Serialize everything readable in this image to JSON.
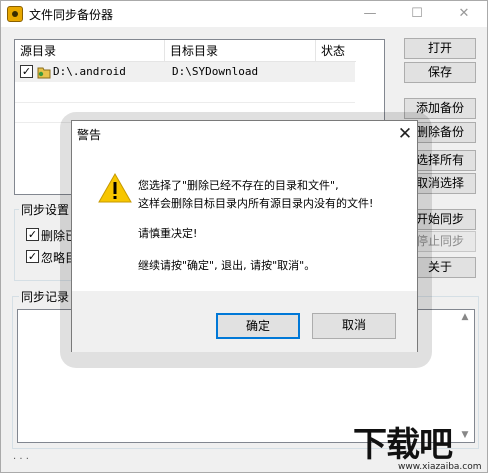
{
  "window": {
    "title": "文件同步备份器",
    "minimize": "—",
    "maximize": "☐",
    "close": "✕"
  },
  "list": {
    "columns": [
      "源目录",
      "目标目录",
      "状态"
    ],
    "rows": [
      {
        "checked": true,
        "source": "D:\\.android",
        "target": "D:\\SYDownload",
        "status": ""
      }
    ]
  },
  "buttons": {
    "open": "打开",
    "save": "保存",
    "add_backup": "添加备份",
    "delete_backup": "删除备份",
    "select_all": "选择所有",
    "deselect": "取消选择",
    "start_sync": "开始同步",
    "stop_sync": "停止同步",
    "about": "关于"
  },
  "sync_settings": {
    "label": "同步设置",
    "option1": {
      "label": "删除已",
      "checked": true
    },
    "option2": {
      "label": "忽略目",
      "checked": true
    }
  },
  "sync_log": {
    "label": "同步记录"
  },
  "statusbar": {
    "text": ". . ."
  },
  "watermark": {
    "logo": "下载吧",
    "url": "www.xiazaiba.com"
  },
  "dialog": {
    "title": "警告",
    "close": "✕",
    "icon": "warning-icon",
    "line1": "您选择了\"删除已经不存在的目录和文件\",",
    "line2": "这样会删除目标目录内所有源目录内没有的文件!",
    "line3": "请慎重决定!",
    "line4": "继续请按\"确定\", 退出, 请按\"取消\"。",
    "ok": "确定",
    "cancel": "取消"
  }
}
